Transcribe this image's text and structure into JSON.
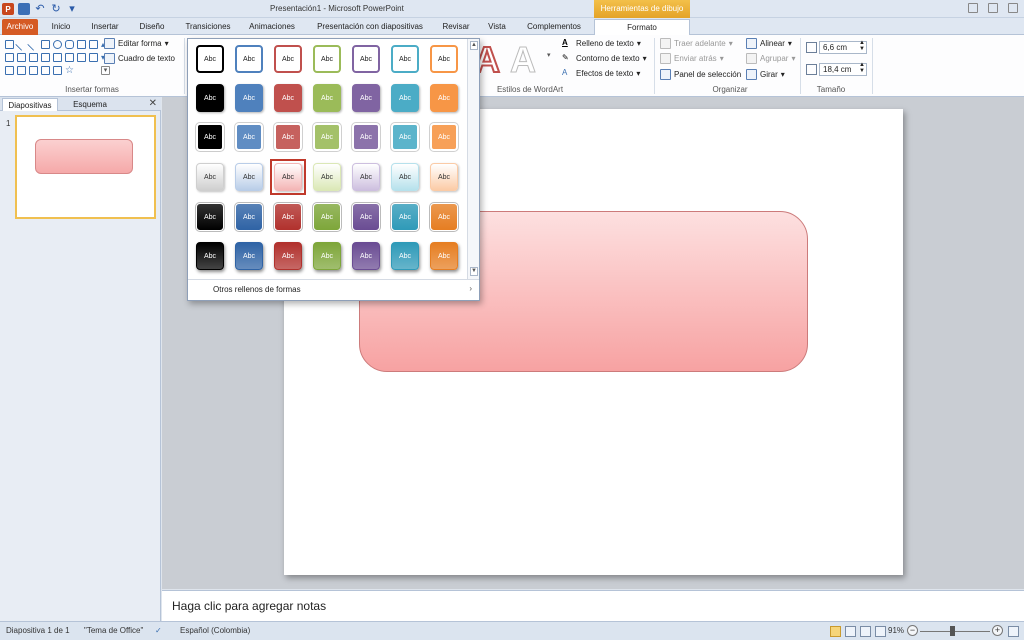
{
  "window": {
    "title": "Presentación1  -  Microsoft PowerPoint",
    "context_tab_title": "Herramientas de dibujo",
    "app_logo_letter": "P"
  },
  "tabs": [
    {
      "label": "Archivo"
    },
    {
      "label": "Inicio"
    },
    {
      "label": "Insertar"
    },
    {
      "label": "Diseño"
    },
    {
      "label": "Transiciones"
    },
    {
      "label": "Animaciones"
    },
    {
      "label": "Presentación con diapositivas"
    },
    {
      "label": "Revisar"
    },
    {
      "label": "Vista"
    },
    {
      "label": "Complementos"
    },
    {
      "label": "Formato"
    }
  ],
  "ribbon": {
    "insert_shapes": {
      "label": "Insertar formas",
      "edit_shape": "Editar forma",
      "text_box": "Cuadro de texto"
    },
    "wordart": {
      "label": "Estilos de WordArt",
      "text_fill": "Relleno de texto",
      "text_outline": "Contorno de texto",
      "text_effects": "Efectos de texto",
      "letter": "A"
    },
    "arrange": {
      "label": "Organizar",
      "bring_forward": "Traer adelante",
      "send_backward": "Enviar atrás",
      "selection_pane": "Panel de selección",
      "align": "Alinear",
      "group": "Agrupar",
      "rotate": "Girar"
    },
    "size": {
      "label": "Tamaño",
      "height": "6,6 cm",
      "width": "18,4 cm"
    }
  },
  "left_pane": {
    "tab_slides": "Diapositivas",
    "tab_outline": "Esquema",
    "close": "✕",
    "slide_number": "1"
  },
  "gallery": {
    "cell_label": "Abc",
    "footer": "Otros rellenos de formas",
    "rows": [
      {
        "style": "outline",
        "colors": [
          "#000000",
          "#4f81bd",
          "#c0504d",
          "#9bbb59",
          "#8064a2",
          "#4bacc6",
          "#f79646"
        ]
      },
      {
        "style": "solid",
        "colors": [
          "#000000",
          "#4f81bd",
          "#c0504d",
          "#9bbb59",
          "#8064a2",
          "#4bacc6",
          "#f79646"
        ]
      },
      {
        "style": "solid-light",
        "colors": [
          "#000000",
          "#4f81bd",
          "#c0504d",
          "#9bbb59",
          "#8064a2",
          "#4bacc6",
          "#f79646"
        ]
      },
      {
        "style": "gradient-pale",
        "colors": [
          "#cfcfcf",
          "#b9cde8",
          "#f4b5b5",
          "#dbe8b6",
          "#cdbfdf",
          "#b6e1ec",
          "#fbcba6"
        ]
      },
      {
        "style": "gradient-strong",
        "colors": [
          "#000000",
          "#2f63a5",
          "#b1312d",
          "#7ea63a",
          "#6a4c93",
          "#2f9ab8",
          "#e67e22"
        ]
      },
      {
        "style": "intense",
        "colors": [
          "#000000",
          "#2f63a5",
          "#b1312d",
          "#7ea63a",
          "#6a4c93",
          "#2f9ab8",
          "#e67e22"
        ]
      }
    ],
    "selected": {
      "row": 3,
      "col": 2
    }
  },
  "notes": {
    "placeholder": "Haga clic para agregar notas"
  },
  "status": {
    "slide_info": "Diapositiva 1 de 1",
    "theme": "\"Tema de Office\"",
    "language": "Español (Colombia)",
    "zoom": "91%",
    "zoom_minus": "−",
    "zoom_plus": "+"
  },
  "colors": {
    "file_tab": "#d55a24",
    "context_tab": "#f0b43d",
    "shape_fill_top": "#fde0e0",
    "shape_fill_bottom": "#f7a2a2",
    "selection_frame": "#c0392b"
  }
}
